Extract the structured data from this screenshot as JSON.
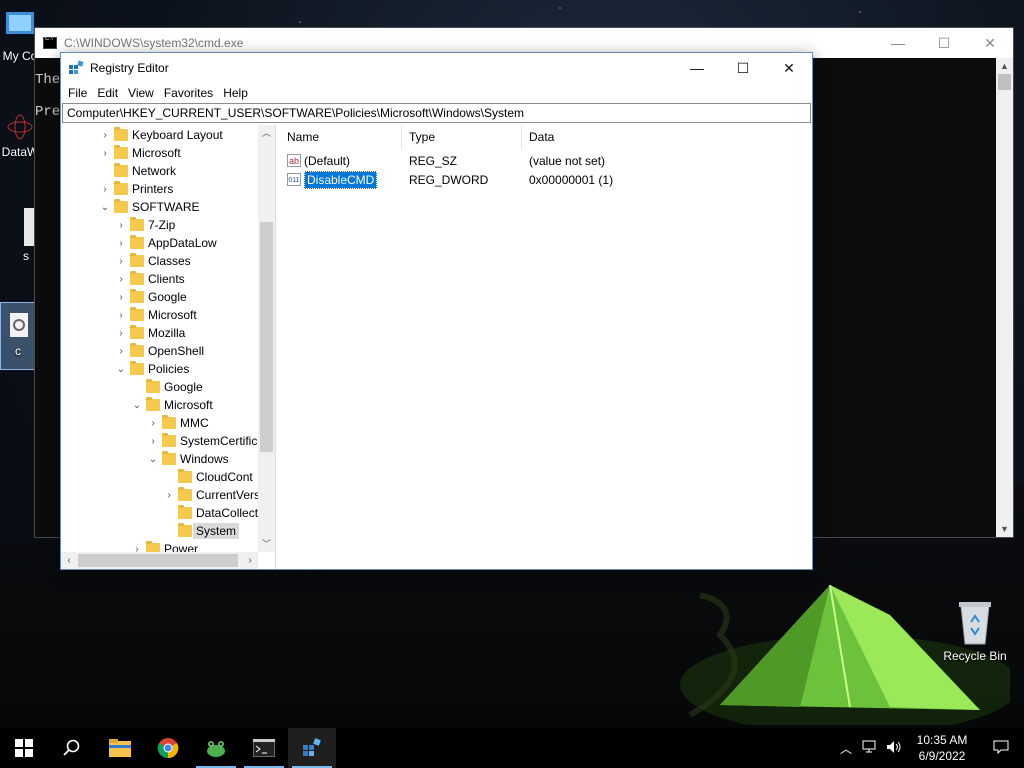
{
  "desktop": {
    "icons": [
      {
        "label": "My Co"
      },
      {
        "label": "DataW"
      },
      {
        "label": "s"
      },
      {
        "label": "c"
      }
    ],
    "recycle_bin_label": "Recycle Bin"
  },
  "cmd_window": {
    "title": "C:\\WINDOWS\\system32\\cmd.exe",
    "lines": [
      "The",
      "",
      "Pre"
    ]
  },
  "regedit": {
    "title": "Registry Editor",
    "menu": [
      "File",
      "Edit",
      "View",
      "Favorites",
      "Help"
    ],
    "address": "Computer\\HKEY_CURRENT_USER\\SOFTWARE\\Policies\\Microsoft\\Windows\\System",
    "tree": [
      {
        "label": "Keyboard Layout",
        "chev": "›"
      },
      {
        "label": "Microsoft",
        "chev": "›"
      },
      {
        "label": "Network",
        "chev": ""
      },
      {
        "label": "Printers",
        "chev": "›"
      },
      {
        "label": "SOFTWARE",
        "chev": "⌄"
      },
      {
        "label": "7-Zip",
        "chev": "›"
      },
      {
        "label": "AppDataLow",
        "chev": "›"
      },
      {
        "label": "Classes",
        "chev": "›"
      },
      {
        "label": "Clients",
        "chev": "›"
      },
      {
        "label": "Google",
        "chev": "›"
      },
      {
        "label": "Microsoft",
        "chev": "›"
      },
      {
        "label": "Mozilla",
        "chev": "›"
      },
      {
        "label": "OpenShell",
        "chev": "›"
      },
      {
        "label": "Policies",
        "chev": "⌄"
      },
      {
        "label": "Google",
        "chev": ""
      },
      {
        "label": "Microsoft",
        "chev": "⌄"
      },
      {
        "label": "MMC",
        "chev": "›"
      },
      {
        "label": "SystemCertific",
        "chev": "›"
      },
      {
        "label": "Windows",
        "chev": "⌄"
      },
      {
        "label": "CloudCont",
        "chev": ""
      },
      {
        "label": "CurrentVers",
        "chev": "›"
      },
      {
        "label": "DataCollect",
        "chev": ""
      },
      {
        "label": "System",
        "chev": "",
        "selected": true
      },
      {
        "label": "Power",
        "chev": "›"
      }
    ],
    "columns": [
      "Name",
      "Type",
      "Data"
    ],
    "values": [
      {
        "name": "(Default)",
        "type": "REG_SZ",
        "data": "(value not set)",
        "icon": "ab"
      },
      {
        "name": "DisableCMD",
        "type": "REG_DWORD",
        "data": "0x00000001 (1)",
        "icon": "011",
        "selected": true
      }
    ]
  },
  "taskbar": {
    "apps": [
      "start",
      "search",
      "file-explorer",
      "chrome",
      "frog-app",
      "cmd",
      "regedit"
    ],
    "time": "10:35 AM",
    "date": "6/9/2022"
  },
  "colors": {
    "selection": "#0078d7",
    "folder": "#f4c94c",
    "tent": "#8ee04a"
  }
}
